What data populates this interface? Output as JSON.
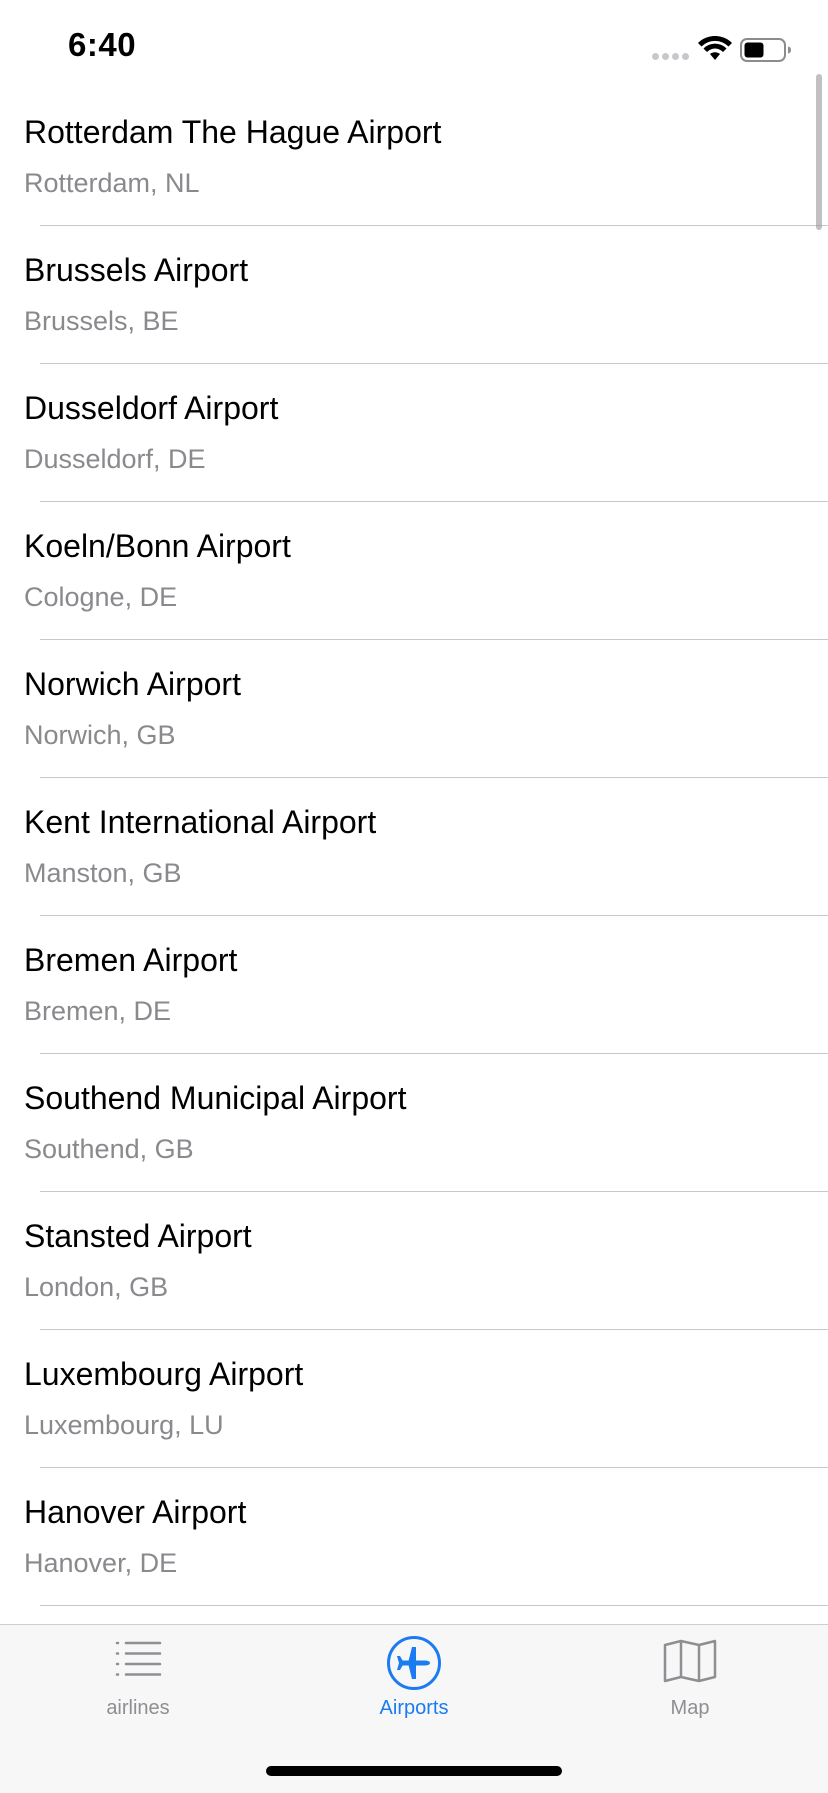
{
  "status_bar": {
    "time": "6:40"
  },
  "airports": [
    {
      "name": "Rotterdam The Hague Airport",
      "location": "Rotterdam, NL"
    },
    {
      "name": "Brussels Airport",
      "location": "Brussels, BE"
    },
    {
      "name": "Dusseldorf Airport",
      "location": "Dusseldorf, DE"
    },
    {
      "name": "Koeln/Bonn Airport",
      "location": "Cologne, DE"
    },
    {
      "name": "Norwich Airport",
      "location": "Norwich, GB"
    },
    {
      "name": "Kent International Airport",
      "location": "Manston, GB"
    },
    {
      "name": "Bremen Airport",
      "location": "Bremen, DE"
    },
    {
      "name": "Southend Municipal Airport",
      "location": "Southend, GB"
    },
    {
      "name": "Stansted Airport",
      "location": "London, GB"
    },
    {
      "name": "Luxembourg Airport",
      "location": "Luxembourg, LU"
    },
    {
      "name": "Hanover Airport",
      "location": "Hanover, DE"
    }
  ],
  "tab_bar": {
    "tabs": [
      {
        "label": "airlines",
        "icon": "list-icon",
        "active": false
      },
      {
        "label": "Airports",
        "icon": "airplane-icon",
        "active": true
      },
      {
        "label": "Map",
        "icon": "map-icon",
        "active": false
      }
    ]
  },
  "colors": {
    "accent": "#1a7cf0",
    "secondary_text": "#8a8a8e",
    "separator": "#c8c7cc",
    "tab_bar_bg": "#f7f7f7"
  }
}
